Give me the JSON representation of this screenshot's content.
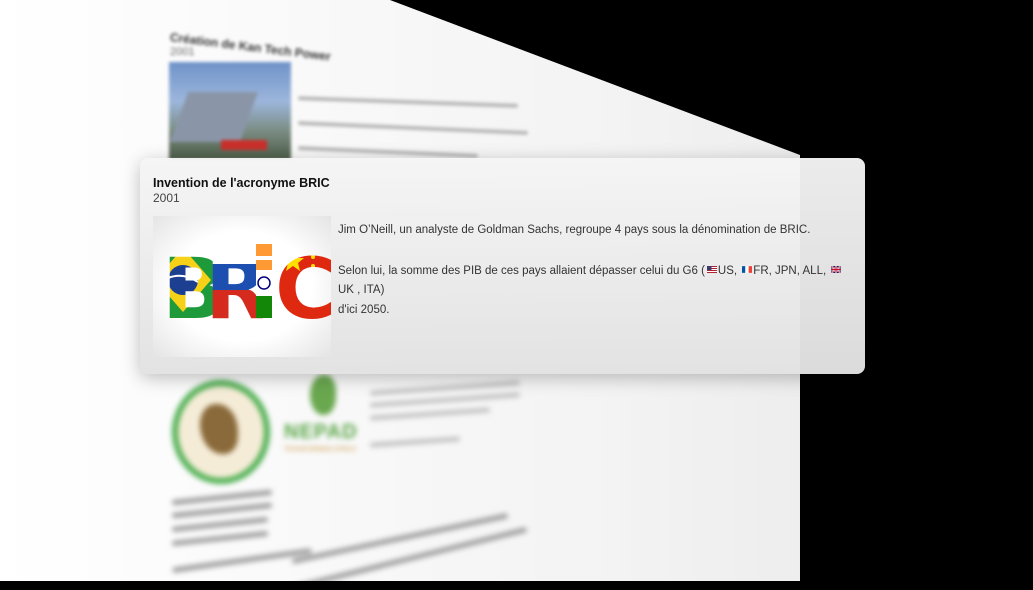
{
  "background_page": {
    "item_title": "Création de Kan Tech Power",
    "item_year": "2001"
  },
  "card": {
    "title": "Invention de l'acronyme BRIC",
    "year": "2001",
    "paragraph1": "Jim O’Neill, un analyste de Goldman Sachs, regroupe 4 pays sous la dénomination de BRIC.",
    "paragraph2_prefix": "Selon lui, la somme des PIB de ces pays allaient dépasser celui du G6 (",
    "country_us": "US, ",
    "country_fr": "FR, JPN, ALL, ",
    "country_uk": "UK , ITA)",
    "paragraph2_suffix": "d'ici 2050.",
    "image_letters": [
      "B",
      "R",
      "I",
      "C"
    ]
  },
  "nepad": {
    "title": "NEPAD",
    "subtitle": "TRANSFORMING AFRICA"
  }
}
